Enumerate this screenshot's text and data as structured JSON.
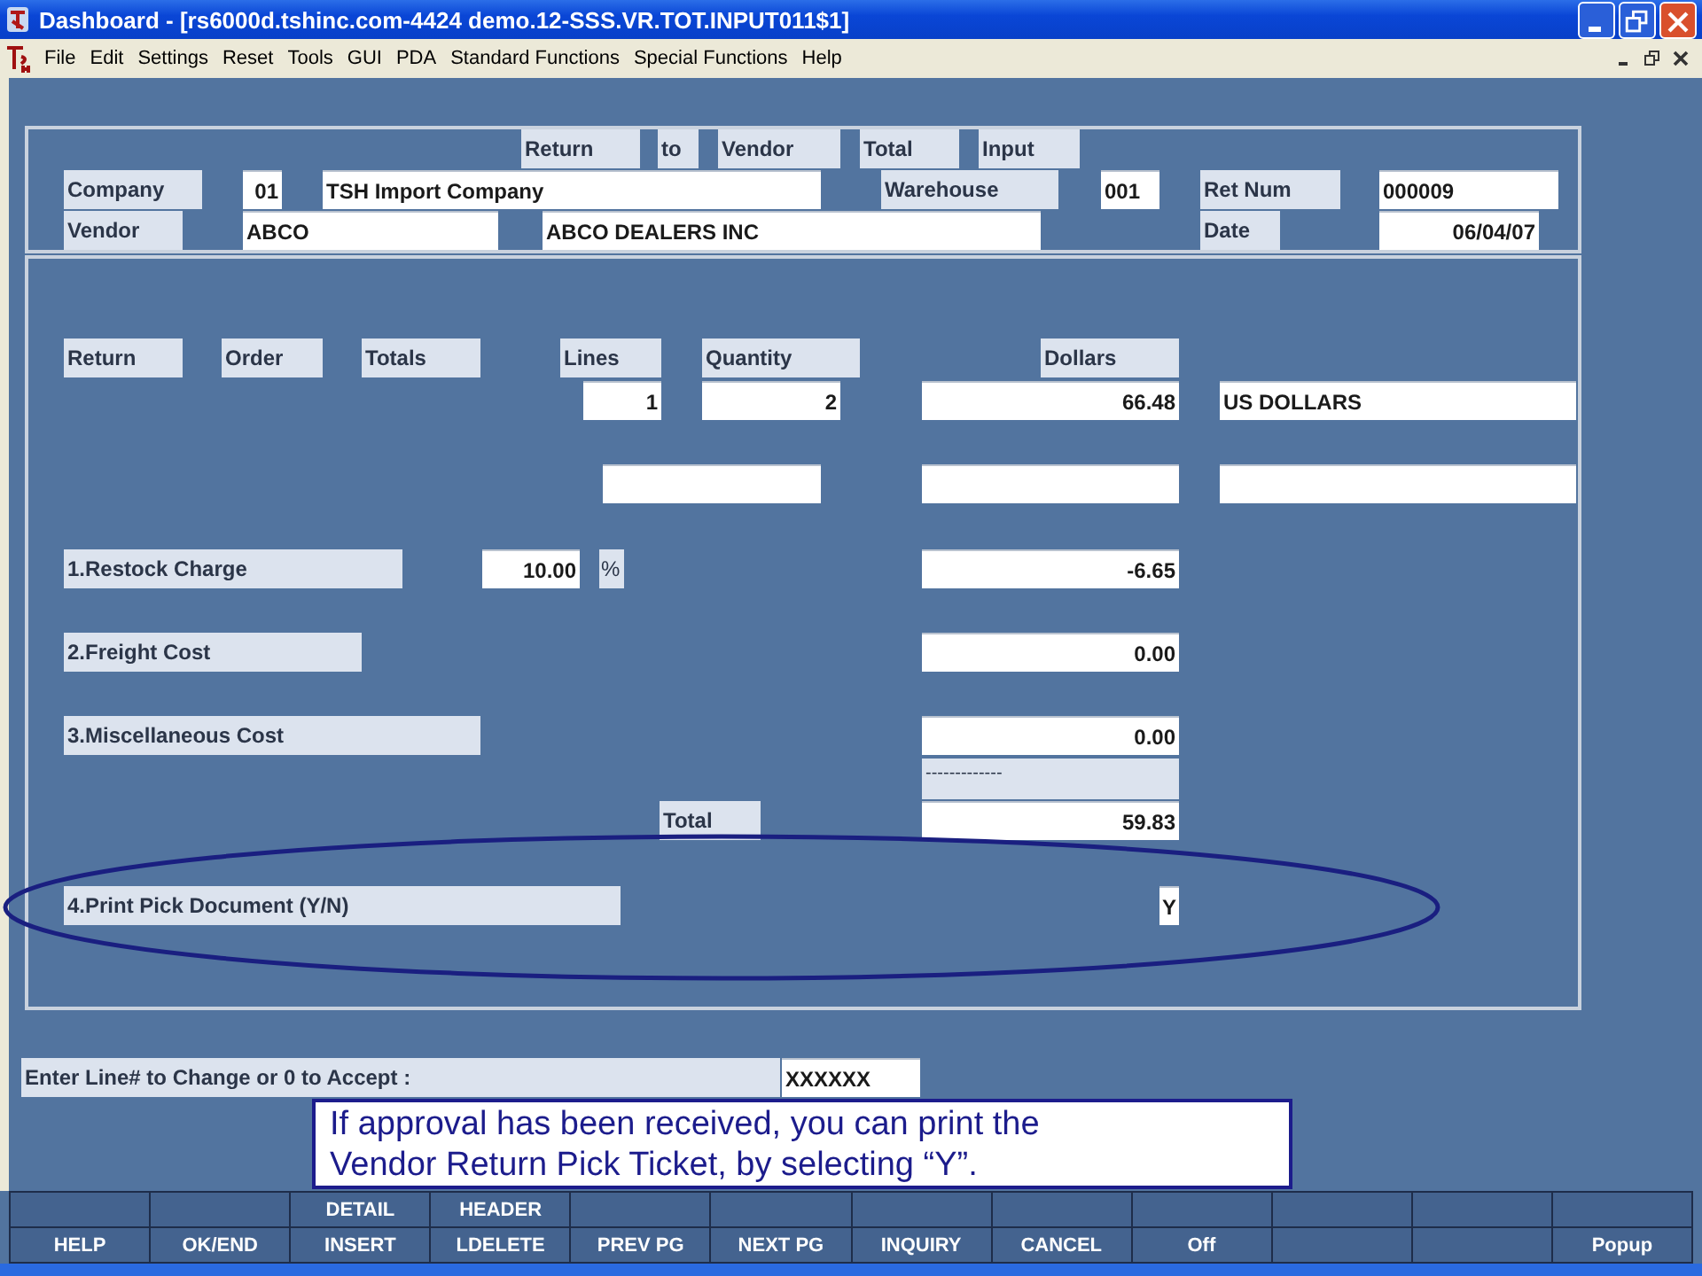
{
  "window": {
    "title": "Dashboard - [rs6000d.tshinc.com-4424 demo.12-SSS.VR.TOT.INPUT011$1]"
  },
  "menu": [
    "File",
    "Edit",
    "Settings",
    "Reset",
    "Tools",
    "GUI",
    "PDA",
    "Standard Functions",
    "Special Functions",
    "Help"
  ],
  "screen_title": [
    "Return",
    "to",
    "Vendor",
    "Total",
    "Input"
  ],
  "header": {
    "company_label": "Company",
    "company_code": "01",
    "company_name": "TSH Import Company",
    "warehouse_label": "Warehouse",
    "warehouse": "001",
    "ret_num_label": "Ret Num",
    "ret_num": "000009",
    "vendor_label": "Vendor",
    "vendor_code": "ABCO",
    "vendor_name": "ABCO DEALERS INC",
    "date_label": "Date",
    "date": "06/04/07"
  },
  "totals": {
    "column_headers": [
      "Return",
      "Order",
      "Totals",
      "Lines",
      "Quantity",
      "Dollars"
    ],
    "lines": "1",
    "quantity": "2",
    "dollars": "66.48",
    "currency": "US DOLLARS"
  },
  "charges": [
    {
      "label": "1.Restock Charge",
      "percent": "10.00",
      "percent_sign": "%",
      "amount": "-6.65"
    },
    {
      "label": "2.Freight Cost",
      "amount": "0.00"
    },
    {
      "label": "3.Miscellaneous Cost",
      "amount": "0.00"
    }
  ],
  "separator": "-------------",
  "total_label": "Total",
  "total": "59.83",
  "print_pick": {
    "label": "4.Print Pick Document (Y/N)",
    "value": "Y"
  },
  "prompt": {
    "label": "Enter Line# to Change or 0 to Accept :",
    "value": "XXXXXX"
  },
  "callout": "If approval has been received, you can print the Vendor Return Pick Ticket, by selecting “Y”.",
  "function_keys": [
    {
      "kind": "key",
      "label": "HELP"
    },
    {
      "kind": "key",
      "label": "OK/END"
    },
    {
      "kind": "key",
      "upper": "DETAIL",
      "label": "INSERT"
    },
    {
      "kind": "key",
      "upper": "HEADER",
      "label": "LDELETE"
    },
    {
      "kind": "key",
      "label": "PREV PG"
    },
    {
      "kind": "key",
      "label": "NEXT PG"
    },
    {
      "kind": "key",
      "label": "INQUIRY"
    },
    {
      "kind": "key",
      "label": "CANCEL"
    },
    {
      "kind": "key",
      "label": "Off"
    },
    {
      "kind": "blank"
    },
    {
      "kind": "blank"
    },
    {
      "kind": "key",
      "label": "Popup"
    }
  ]
}
